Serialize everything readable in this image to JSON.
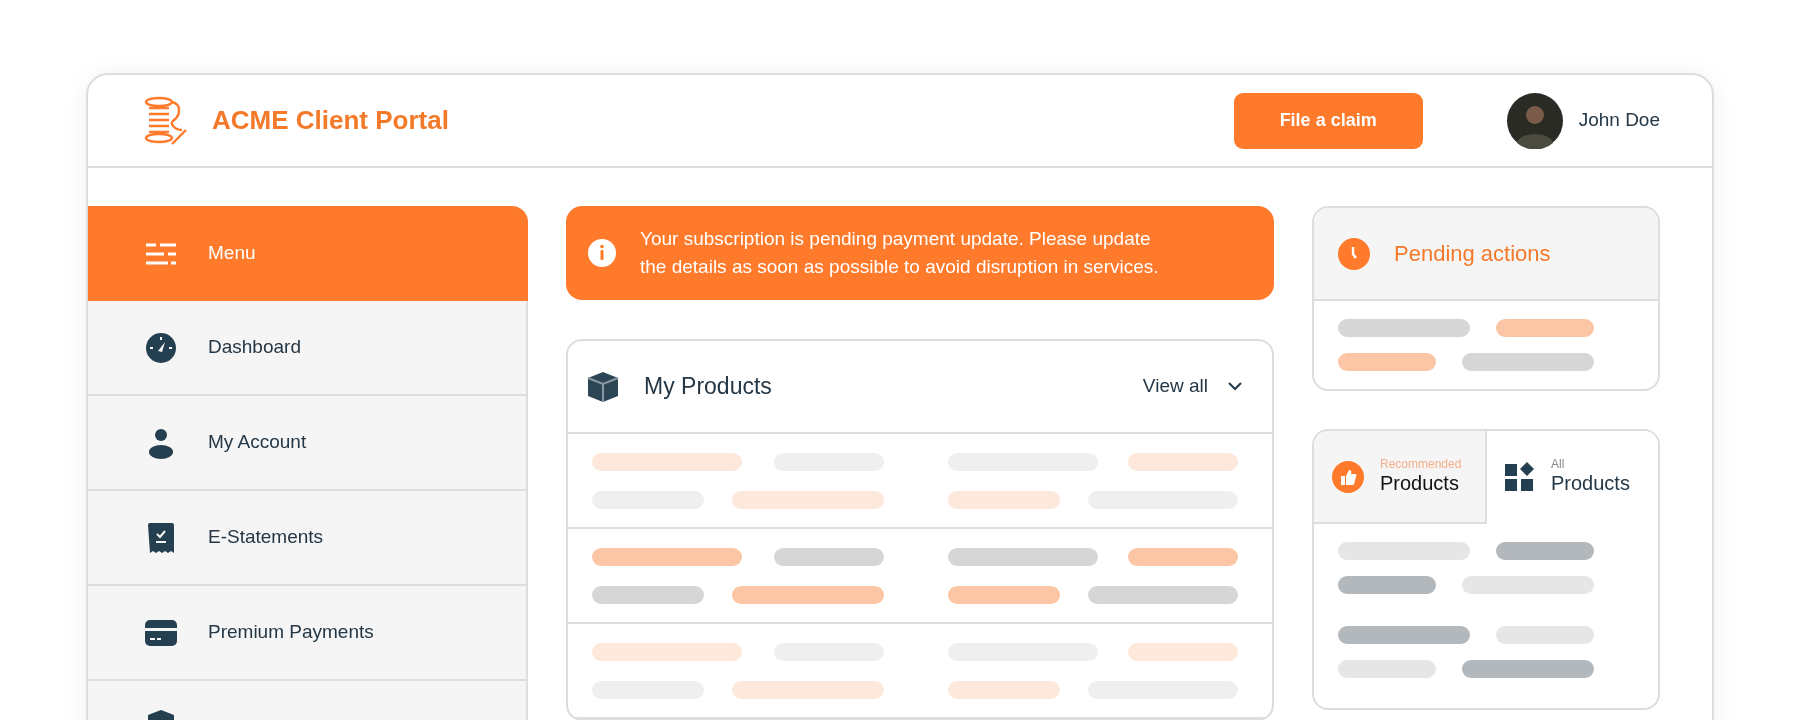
{
  "header": {
    "title": "ACME Client Portal",
    "action_button": "File a claim",
    "user_name": "John Doe"
  },
  "sidebar": {
    "header": "Menu",
    "items": [
      {
        "kind": "dashboard",
        "label": "Dashboard"
      },
      {
        "kind": "account",
        "label": "My Account"
      },
      {
        "kind": "statements",
        "label": "E-Statements"
      },
      {
        "kind": "payments",
        "label": "Premium Payments"
      },
      {
        "kind": "shield"
      }
    ]
  },
  "alert": {
    "text": "Your subscription is pending payment update. Please update the details as soon as possible to avoid disruption in services."
  },
  "products": {
    "title": "My Products",
    "view_all": "View all"
  },
  "pending": {
    "title": "Pending actions"
  },
  "product_tabs": [
    {
      "kind": "recommended",
      "caption": "Recommended",
      "label": "Products",
      "selected": false
    },
    {
      "kind": "all",
      "caption": "All",
      "label": "Products",
      "selected": true
    }
  ]
}
